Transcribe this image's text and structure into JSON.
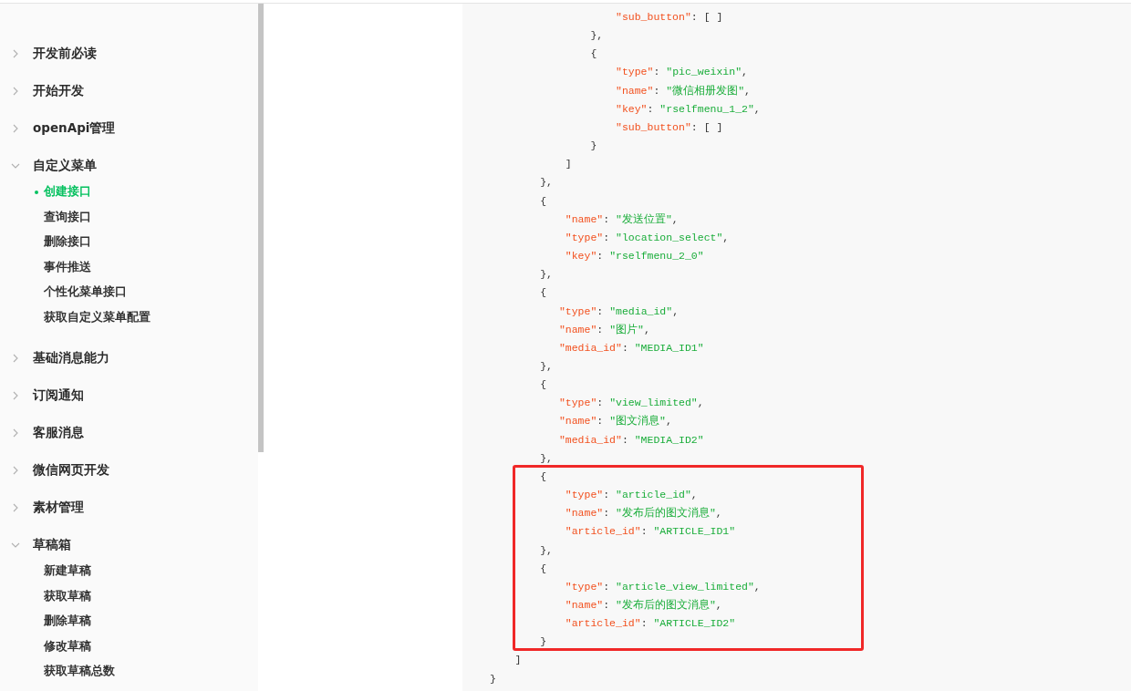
{
  "sidebar": {
    "items": [
      {
        "label": "开发前必读",
        "expanded": false
      },
      {
        "label": "开始开发",
        "expanded": false
      },
      {
        "label": "openApi管理",
        "expanded": false
      },
      {
        "label": "自定义菜单",
        "expanded": true,
        "children": [
          {
            "label": "创建接口",
            "selected": true
          },
          {
            "label": "查询接口",
            "selected": false
          },
          {
            "label": "删除接口",
            "selected": false
          },
          {
            "label": "事件推送",
            "selected": false
          },
          {
            "label": "个性化菜单接口",
            "selected": false
          },
          {
            "label": "获取自定义菜单配置",
            "selected": false
          }
        ]
      },
      {
        "label": "基础消息能力",
        "expanded": false
      },
      {
        "label": "订阅通知",
        "expanded": false
      },
      {
        "label": "客服消息",
        "expanded": false
      },
      {
        "label": "微信网页开发",
        "expanded": false
      },
      {
        "label": "素材管理",
        "expanded": false
      },
      {
        "label": "草稿箱",
        "expanded": true,
        "children": [
          {
            "label": "新建草稿",
            "selected": false
          },
          {
            "label": "获取草稿",
            "selected": false
          },
          {
            "label": "删除草稿",
            "selected": false
          },
          {
            "label": "修改草稿",
            "selected": false
          },
          {
            "label": "获取草稿总数",
            "selected": false
          }
        ]
      }
    ]
  },
  "code": {
    "segments": [
      {
        "highlighted": false,
        "lines": [
          "                    \"sub_button\": [ ]",
          "                },",
          "                {",
          "                    \"type\": \"pic_weixin\",",
          "                    \"name\": \"微信相册发图\",",
          "                    \"key\": \"rselfmenu_1_2\",",
          "                    \"sub_button\": [ ]",
          "                }",
          "            ]",
          "        },",
          "        {",
          "            \"name\": \"发送位置\",",
          "            \"type\": \"location_select\",",
          "            \"key\": \"rselfmenu_2_0\"",
          "        },",
          "        {",
          "           \"type\": \"media_id\",",
          "           \"name\": \"图片\",",
          "           \"media_id\": \"MEDIA_ID1\"",
          "        },",
          "        {",
          "           \"type\": \"view_limited\",",
          "           \"name\": \"图文消息\",",
          "           \"media_id\": \"MEDIA_ID2\"",
          "        },"
        ]
      },
      {
        "highlighted": true,
        "lines": [
          "        {",
          "            \"type\": \"article_id\",",
          "            \"name\": \"发布后的图文消息\",",
          "            \"article_id\": \"ARTICLE_ID1\"",
          "        },",
          "        {",
          "            \"type\": \"article_view_limited\",",
          "            \"name\": \"发布后的图文消息\",",
          "            \"article_id\": \"ARTICLE_ID2\"",
          "        }"
        ]
      },
      {
        "highlighted": false,
        "lines": [
          "    ]",
          "}"
        ]
      }
    ]
  }
}
